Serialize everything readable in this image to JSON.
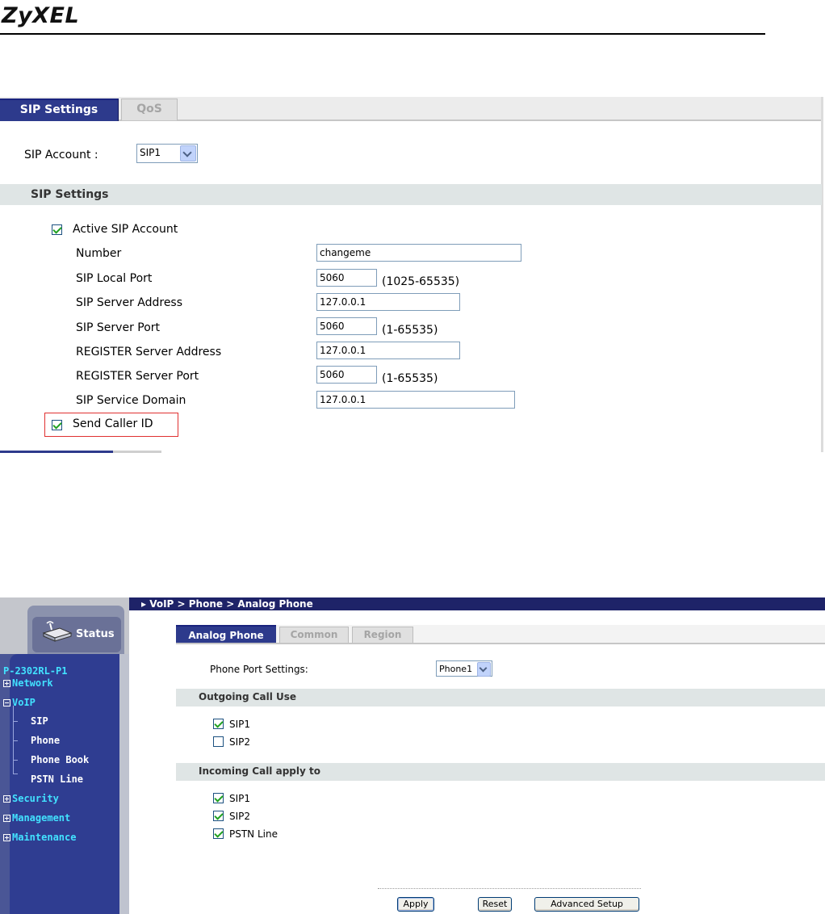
{
  "header": {
    "logo": "ZyXEL"
  },
  "panel1": {
    "tabs": [
      {
        "label": "SIP Settings",
        "active": true
      },
      {
        "label": "QoS",
        "active": false
      }
    ],
    "sip_account": {
      "label": "SIP Account :",
      "value": "SIP1"
    },
    "section_title": "SIP Settings",
    "active_account": {
      "label": "Active SIP Account",
      "checked": true
    },
    "fields": {
      "number": {
        "label": "Number",
        "value": "changeme"
      },
      "local_port": {
        "label": "SIP Local Port",
        "value": "5060",
        "hint": "(1025-65535)"
      },
      "server_address": {
        "label": "SIP Server Address",
        "value": "127.0.0.1"
      },
      "server_port": {
        "label": "SIP Server Port",
        "value": "5060",
        "hint": "(1-65535)"
      },
      "register_address": {
        "label": "REGISTER Server Address",
        "value": "127.0.0.1"
      },
      "register_port": {
        "label": "REGISTER Server Port",
        "value": "5060",
        "hint": "(1-65535)"
      },
      "service_domain": {
        "label": "SIP Service Domain",
        "value": "127.0.0.1"
      }
    },
    "send_caller_id": {
      "label": "Send Caller ID",
      "checked": true
    },
    "colors": {
      "tab_active": "#2d3a8c",
      "highlight": "#e03030"
    }
  },
  "panel2": {
    "breadcrumb": "VoIP > Phone > Analog Phone",
    "status_label": "Status",
    "device": "P-2302RL-P1",
    "nav": {
      "network": "Network",
      "voip": "VoIP",
      "sip": "SIP",
      "phone": "Phone",
      "phone_book": "Phone Book",
      "pstn_line": "PSTN Line",
      "security": "Security",
      "management": "Management",
      "maintenance": "Maintenance"
    },
    "tabs": [
      {
        "label": "Analog Phone",
        "active": true
      },
      {
        "label": "Common",
        "active": false
      },
      {
        "label": "Region",
        "active": false
      }
    ],
    "port_settings": {
      "label": "Phone Port Settings:",
      "value": "Phone1"
    },
    "outgoing": {
      "title": "Outgoing Call Use",
      "items": [
        {
          "label": "SIP1",
          "checked": true
        },
        {
          "label": "SIP2",
          "checked": false
        }
      ]
    },
    "incoming": {
      "title": "Incoming Call apply to",
      "items": [
        {
          "label": "SIP1",
          "checked": true
        },
        {
          "label": "SIP2",
          "checked": true
        },
        {
          "label": "PSTN Line",
          "checked": true
        }
      ]
    },
    "buttons": {
      "apply": "Apply",
      "reset": "Reset",
      "advanced": "Advanced Setup"
    },
    "colors": {
      "nav_bg": "#2f3d91",
      "nav_highlight": "#42e2ff",
      "crumb_bar": "#1e2368"
    }
  }
}
